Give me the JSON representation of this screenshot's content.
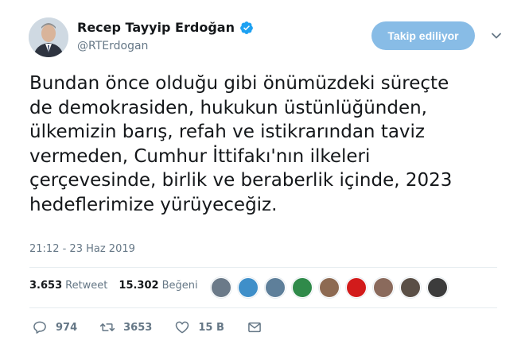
{
  "author": {
    "display_name": "Recep Tayyip Erdoğan",
    "handle": "@RTErdogan"
  },
  "follow_button": {
    "label": "Takip ediliyor"
  },
  "tweet": {
    "lines": [
      "Bundan önce olduğu gibi önümüzdeki süreçte",
      "de demokrasiden, hukukun üstünlüğünden,",
      "ülkemizin barış, refah ve istikrarından taviz",
      "vermeden, Cumhur İttifakı'nın ilkeleri",
      "çerçevesinde, birlik ve beraberlik içinde, 2023",
      "hedeflerimize yürüyeceğiz."
    ],
    "timestamp": "21:12 - 23 Haz 2019"
  },
  "stats": {
    "retweet_count": "3.653",
    "retweet_label": "Retweet",
    "like_count": "15.302",
    "like_label": "Beğeni"
  },
  "likers": [
    {
      "color": "#6b7a89"
    },
    {
      "color": "#3f8fc9"
    },
    {
      "color": "#5e7f9a"
    },
    {
      "color": "#2f8a4a"
    },
    {
      "color": "#8d6a52"
    },
    {
      "color": "#d21b1b"
    },
    {
      "color": "#8a6a5c"
    },
    {
      "color": "#5a4f46"
    },
    {
      "color": "#3c3c3c"
    }
  ],
  "actions": {
    "reply_count": "974",
    "retweet_count": "3653",
    "like_count": "15 B"
  },
  "colors": {
    "accent": "#1da1f2",
    "follow_button": "#88bce6",
    "secondary_text": "#657786"
  }
}
